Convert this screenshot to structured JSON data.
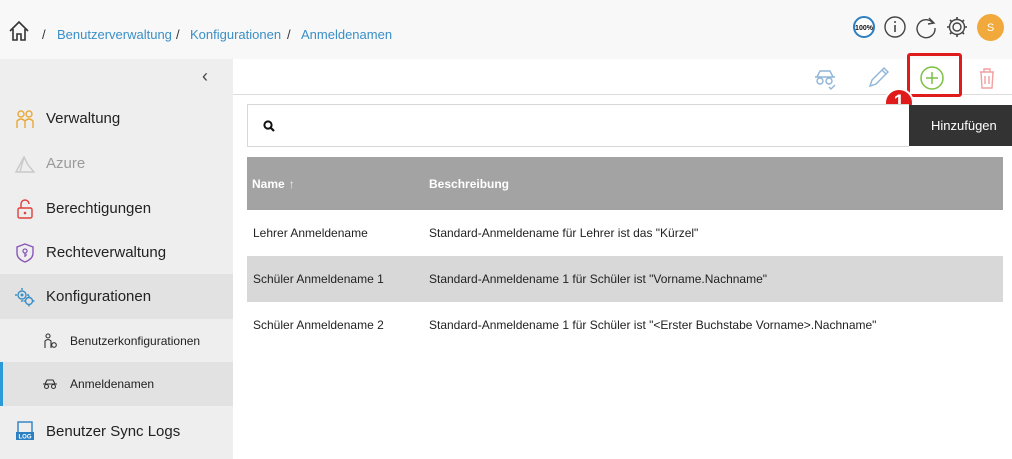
{
  "header": {
    "breadcrumb": [
      "Benutzerverwaltung",
      "Konfigurationen",
      "Anmeldenamen"
    ],
    "separator": "/",
    "zoom_label": "100%",
    "avatar_initial": "S",
    "colors": {
      "link": "#3a8fc6",
      "avatar": "#f2a93b"
    }
  },
  "sidebar": {
    "items": [
      {
        "label": "Verwaltung",
        "icon": "users-icon"
      },
      {
        "label": "Azure",
        "icon": "azure-icon"
      },
      {
        "label": "Berechtigungen",
        "icon": "lock-icon"
      },
      {
        "label": "Rechteverwaltung",
        "icon": "shield-key-icon"
      },
      {
        "label": "Konfigurationen",
        "icon": "gears-icon"
      },
      {
        "label": "Benutzerkonfigurationen",
        "icon": "user-gear-icon"
      },
      {
        "label": "Anmeldenamen",
        "icon": "glasses-icon"
      },
      {
        "label": "Benutzer Sync Logs",
        "icon": "log-icon"
      }
    ]
  },
  "toolbar": {
    "tooltip": "Hinzufügen",
    "step_marker": "1"
  },
  "search": {
    "placeholder": "",
    "value": ""
  },
  "table": {
    "columns": [
      "Name",
      "Beschreibung"
    ],
    "sort_indicator": "↑",
    "rows": [
      {
        "name": "Lehrer Anmeldename",
        "description": "Standard-Anmeldename für Lehrer ist das \"Kürzel\""
      },
      {
        "name": "Schüler Anmeldename 1",
        "description": "Standard-Anmeldename 1 für Schüler ist \"Vorname.Nachname\""
      },
      {
        "name": "Schüler Anmeldename 2",
        "description": "Standard-Anmeldename 1 für Schüler ist \"<Erster Buchstabe Vorname>.Nachname\""
      }
    ]
  }
}
